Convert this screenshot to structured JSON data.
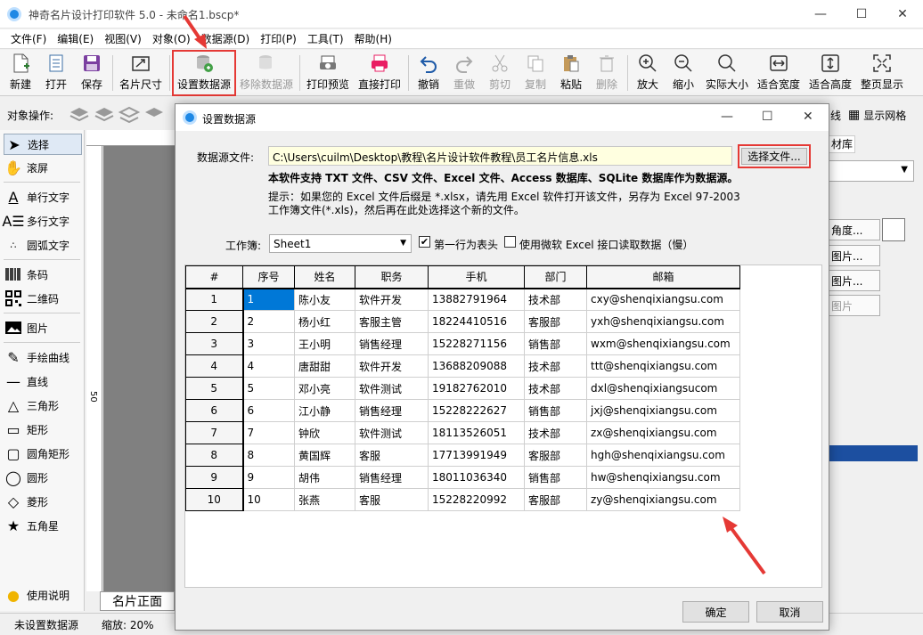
{
  "window": {
    "title": "神奇名片设计打印软件 5.0 - 未命名1.bscp*",
    "min": "—",
    "max": "☐",
    "close": "✕"
  },
  "menu": [
    "文件(F)",
    "编辑(E)",
    "视图(V)",
    "对象(O)",
    "数据源(D)",
    "打印(P)",
    "工具(T)",
    "帮助(H)"
  ],
  "toolbar": {
    "new": "新建",
    "open": "打开",
    "save": "保存",
    "card_size": "名片尺寸",
    "set_datasource": "设置数据源",
    "remove_datasource": "移除数据源",
    "print_preview": "打印预览",
    "direct_print": "直接打印",
    "undo": "撤销",
    "redo": "重做",
    "cut": "剪切",
    "copy": "复制",
    "paste": "粘贴",
    "delete": "删除",
    "zoom_in": "放大",
    "zoom_out": "缩小",
    "actual_size": "实际大小",
    "fit_width": "适合宽度",
    "fit_height": "适合高度",
    "full_page": "整页显示"
  },
  "objbar": {
    "label": "对象操作:",
    "show_grid": "显示网格",
    "partial_tab": "线"
  },
  "left_panel": [
    "选择",
    "滚屏",
    "单行文字",
    "多行文字",
    "圆弧文字",
    "条码",
    "二维码",
    "图片",
    "手绘曲线",
    "直线",
    "三角形",
    "矩形",
    "圆角矩形",
    "圆形",
    "菱形",
    "五角星",
    "使用说明"
  ],
  "ruler_mark": "50",
  "canvas_tab": "名片正面",
  "right_panel": {
    "tab": "材库",
    "b1": "角度...",
    "b2": "图片...",
    "b3": "图片...",
    "b4": "图片"
  },
  "status": {
    "datasource": "未设置数据源",
    "zoom": "缩放: 20%"
  },
  "dialog": {
    "title": "设置数据源",
    "file_label": "数据源文件:",
    "file_path": "C:\\Users\\cuilm\\Desktop\\教程\\名片设计软件教程\\员工名片信息.xls",
    "choose_file": "选择文件...",
    "support_text": "本软件支持 TXT 文件、CSV 文件、Excel 文件、Access 数据库、SQLite 数据库作为数据源。",
    "hint_line1": "提示：如果您的 Excel 文件后缀是 *.xlsx，请先用 Excel 软件打开该文件，另存为 Excel 97-2003",
    "hint_line2": "工作簿文件(*.xls)，然后再在此处选择这个新的文件。",
    "sheet_label": "工作簿:",
    "sheet_value": "Sheet1",
    "first_row_header": "第一行为表头",
    "use_ms_excel": "使用微软 Excel 接口读取数据（慢）",
    "ok": "确定",
    "cancel": "取消"
  },
  "grid": {
    "columns": [
      "#",
      "序号",
      "姓名",
      "职务",
      "手机",
      "部门",
      "邮箱"
    ],
    "rows": [
      [
        "1",
        "1",
        "陈小友",
        "软件开发",
        "13882791964",
        "技术部",
        "cxy@shenqixiangsu.com"
      ],
      [
        "2",
        "2",
        "杨小红",
        "客服主管",
        "18224410516",
        "客服部",
        "yxh@shenqixiangsu.com"
      ],
      [
        "3",
        "3",
        "王小明",
        "销售经理",
        "15228271156",
        "销售部",
        "wxm@shenqixiangsu.com"
      ],
      [
        "4",
        "4",
        "唐甜甜",
        "软件开发",
        "13688209088",
        "技术部",
        "ttt@shenqixiangsu.com"
      ],
      [
        "5",
        "5",
        "邓小亮",
        "软件测试",
        "19182762010",
        "技术部",
        "dxl@shenqixiangsucom"
      ],
      [
        "6",
        "6",
        "江小静",
        "销售经理",
        "15228222627",
        "销售部",
        "jxj@shenqixiangsu.com"
      ],
      [
        "7",
        "7",
        "钟欣",
        "软件测试",
        "18113526051",
        "技术部",
        "zx@shenqixiangsu.com"
      ],
      [
        "8",
        "8",
        "黄国辉",
        "客服",
        "17713991949",
        "客服部",
        "hgh@shenqixiangsu.com"
      ],
      [
        "9",
        "9",
        "胡伟",
        "销售经理",
        "18011036340",
        "销售部",
        "hw@shenqixiangsu.com"
      ],
      [
        "10",
        "10",
        "张燕",
        "客服",
        "15228220992",
        "客服部",
        "zy@shenqixiangsu.com"
      ]
    ]
  },
  "colors": {
    "accent": "#0078d7",
    "highlight": "#e53935",
    "selected_cell": "#0078d7"
  }
}
